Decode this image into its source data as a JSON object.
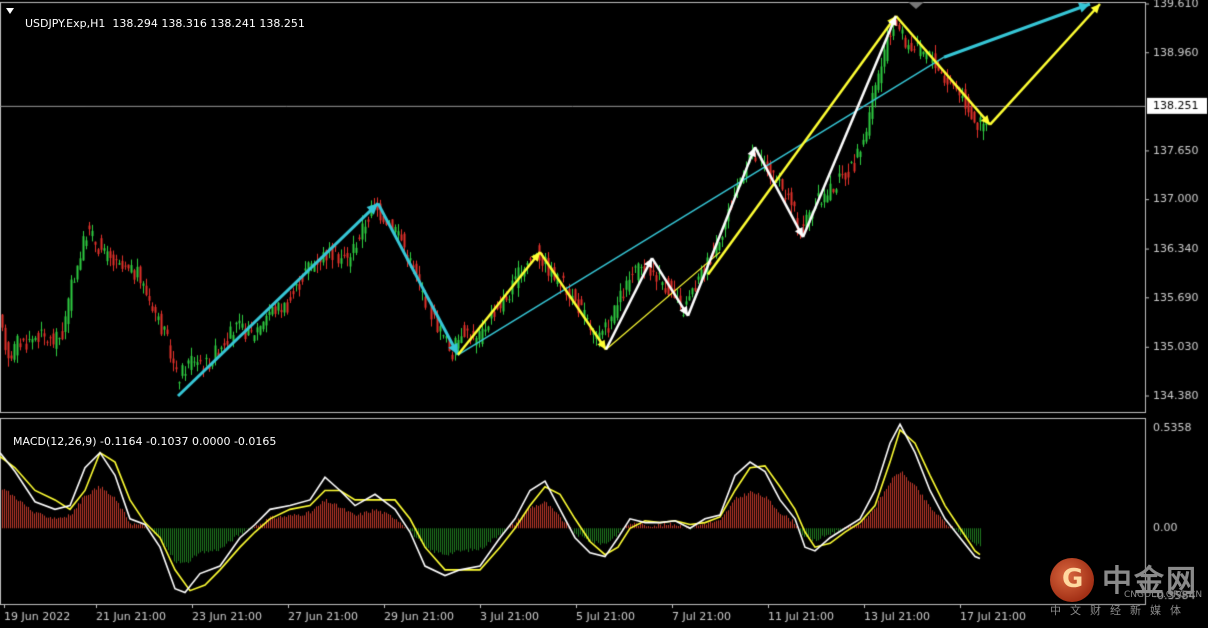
{
  "header": {
    "symbol": "USDJPY.Exp,H1",
    "open": "138.294",
    "high": "138.316",
    "low": "138.241",
    "close": "138.251"
  },
  "macd_header": {
    "name": "MACD(12,26,9)",
    "values": "-0.1164 -0.1037 0.0000 -0.0165"
  },
  "watermark": {
    "logo_glyph": "G",
    "name_cn": "中金网",
    "name_en": "CNGOLD.ORG.CN",
    "subtitle_cn": "中文财经新媒体"
  },
  "colors": {
    "background": "#000000",
    "bull": "#2ecc40",
    "bear": "#e0302a",
    "cyan": "#36c6d6",
    "yellow": "#ffff33",
    "white": "#ffffff",
    "macd_hist_pos": "#c0392b",
    "macd_hist_neg": "#1f7a1f",
    "axis": "#cccccc"
  },
  "chart_data": {
    "type": "candlestick",
    "price_ticks": [
      "139.610",
      "138.960",
      "138.251",
      "137.650",
      "137.000",
      "136.340",
      "135.690",
      "135.030",
      "134.380"
    ],
    "current_price_label": "138.251",
    "macd_ticks": [
      "0.5358",
      "0.00",
      "-0.3584"
    ],
    "time_labels": [
      "19 Jun 2022",
      "21 Jun 21:00",
      "23 Jun 21:00",
      "27 Jun 21:00",
      "29 Jun 21:00",
      "3 Jul 21:00",
      "5 Jul 21:00",
      "7 Jul 21:00",
      "11 Jul 21:00",
      "13 Jul 21:00",
      "17 Jul 21:00"
    ],
    "price_path": [
      [
        0,
        135.5
      ],
      [
        5,
        135.2
      ],
      [
        12,
        134.9
      ],
      [
        20,
        135.1
      ],
      [
        30,
        135.1
      ],
      [
        40,
        135.2
      ],
      [
        55,
        135.1
      ],
      [
        65,
        135.2
      ],
      [
        75,
        135.9
      ],
      [
        90,
        136.6
      ],
      [
        105,
        136.3
      ],
      [
        120,
        136.1
      ],
      [
        140,
        136.0
      ],
      [
        155,
        135.6
      ],
      [
        170,
        135.1
      ],
      [
        180,
        134.6
      ],
      [
        195,
        134.9
      ],
      [
        210,
        134.8
      ],
      [
        225,
        135.1
      ],
      [
        240,
        135.3
      ],
      [
        255,
        135.2
      ],
      [
        270,
        135.5
      ],
      [
        290,
        135.6
      ],
      [
        310,
        136.1
      ],
      [
        330,
        136.3
      ],
      [
        350,
        136.2
      ],
      [
        365,
        136.6
      ],
      [
        375,
        136.9
      ],
      [
        385,
        136.8
      ],
      [
        400,
        136.6
      ],
      [
        415,
        136.1
      ],
      [
        430,
        135.6
      ],
      [
        445,
        135.2
      ],
      [
        455,
        134.95
      ],
      [
        465,
        135.3
      ],
      [
        480,
        135.1
      ],
      [
        495,
        135.5
      ],
      [
        510,
        135.7
      ],
      [
        525,
        136.1
      ],
      [
        540,
        136.3
      ],
      [
        555,
        136.0
      ],
      [
        570,
        135.8
      ],
      [
        585,
        135.5
      ],
      [
        600,
        135.1
      ],
      [
        610,
        135.3
      ],
      [
        620,
        135.6
      ],
      [
        635,
        136.0
      ],
      [
        648,
        136.1
      ],
      [
        660,
        136.0
      ],
      [
        672,
        135.8
      ],
      [
        685,
        135.5
      ],
      [
        700,
        135.9
      ],
      [
        715,
        136.3
      ],
      [
        728,
        136.7
      ],
      [
        740,
        137.2
      ],
      [
        752,
        137.6
      ],
      [
        765,
        137.5
      ],
      [
        780,
        137.2
      ],
      [
        792,
        137.0
      ],
      [
        803,
        136.6
      ],
      [
        815,
        136.9
      ],
      [
        830,
        137.1
      ],
      [
        845,
        137.3
      ],
      [
        858,
        137.5
      ],
      [
        868,
        137.9
      ],
      [
        878,
        138.5
      ],
      [
        890,
        139.1
      ],
      [
        898,
        139.4
      ],
      [
        908,
        139.1
      ],
      [
        920,
        139.0
      ],
      [
        935,
        138.9
      ],
      [
        948,
        138.6
      ],
      [
        960,
        138.5
      ],
      [
        972,
        138.2
      ],
      [
        980,
        138.0
      ],
      [
        988,
        138.0
      ]
    ],
    "macd_line": [
      [
        0,
        0.4
      ],
      [
        15,
        0.3
      ],
      [
        35,
        0.14
      ],
      [
        55,
        0.1
      ],
      [
        70,
        0.12
      ],
      [
        85,
        0.32
      ],
      [
        100,
        0.4
      ],
      [
        115,
        0.28
      ],
      [
        130,
        0.05
      ],
      [
        145,
        0.02
      ],
      [
        160,
        -0.1
      ],
      [
        175,
        -0.32
      ],
      [
        185,
        -0.34
      ],
      [
        200,
        -0.24
      ],
      [
        220,
        -0.2
      ],
      [
        240,
        -0.05
      ],
      [
        255,
        0.02
      ],
      [
        270,
        0.1
      ],
      [
        290,
        0.12
      ],
      [
        310,
        0.15
      ],
      [
        325,
        0.27
      ],
      [
        340,
        0.2
      ],
      [
        355,
        0.12
      ],
      [
        375,
        0.18
      ],
      [
        395,
        0.1
      ],
      [
        410,
        -0.02
      ],
      [
        425,
        -0.2
      ],
      [
        445,
        -0.25
      ],
      [
        460,
        -0.22
      ],
      [
        480,
        -0.2
      ],
      [
        500,
        -0.05
      ],
      [
        515,
        0.05
      ],
      [
        530,
        0.2
      ],
      [
        545,
        0.25
      ],
      [
        560,
        0.1
      ],
      [
        575,
        -0.05
      ],
      [
        590,
        -0.13
      ],
      [
        605,
        -0.15
      ],
      [
        618,
        -0.05
      ],
      [
        630,
        0.05
      ],
      [
        645,
        0.03
      ],
      [
        660,
        0.03
      ],
      [
        675,
        0.04
      ],
      [
        690,
        0.0
      ],
      [
        705,
        0.05
      ],
      [
        720,
        0.07
      ],
      [
        735,
        0.28
      ],
      [
        750,
        0.35
      ],
      [
        765,
        0.3
      ],
      [
        780,
        0.15
      ],
      [
        795,
        0.05
      ],
      [
        805,
        -0.1
      ],
      [
        815,
        -0.12
      ],
      [
        830,
        -0.05
      ],
      [
        845,
        0.0
      ],
      [
        860,
        0.05
      ],
      [
        875,
        0.2
      ],
      [
        890,
        0.45
      ],
      [
        900,
        0.55
      ],
      [
        915,
        0.4
      ],
      [
        930,
        0.2
      ],
      [
        945,
        0.05
      ],
      [
        960,
        -0.05
      ],
      [
        975,
        -0.15
      ],
      [
        980,
        -0.16
      ]
    ],
    "signal_line": [
      [
        0,
        0.38
      ],
      [
        15,
        0.32
      ],
      [
        35,
        0.2
      ],
      [
        55,
        0.15
      ],
      [
        70,
        0.1
      ],
      [
        85,
        0.2
      ],
      [
        100,
        0.4
      ],
      [
        115,
        0.35
      ],
      [
        130,
        0.15
      ],
      [
        145,
        0.03
      ],
      [
        160,
        -0.05
      ],
      [
        175,
        -0.22
      ],
      [
        190,
        -0.33
      ],
      [
        205,
        -0.3
      ],
      [
        220,
        -0.22
      ],
      [
        240,
        -0.1
      ],
      [
        255,
        -0.02
      ],
      [
        270,
        0.05
      ],
      [
        290,
        0.1
      ],
      [
        310,
        0.12
      ],
      [
        325,
        0.2
      ],
      [
        340,
        0.2
      ],
      [
        355,
        0.15
      ],
      [
        375,
        0.15
      ],
      [
        395,
        0.15
      ],
      [
        410,
        0.05
      ],
      [
        425,
        -0.1
      ],
      [
        445,
        -0.22
      ],
      [
        460,
        -0.22
      ],
      [
        480,
        -0.22
      ],
      [
        500,
        -0.1
      ],
      [
        515,
        0.0
      ],
      [
        530,
        0.12
      ],
      [
        545,
        0.22
      ],
      [
        560,
        0.18
      ],
      [
        575,
        0.05
      ],
      [
        590,
        -0.07
      ],
      [
        605,
        -0.14
      ],
      [
        618,
        -0.1
      ],
      [
        630,
        0.0
      ],
      [
        645,
        0.04
      ],
      [
        660,
        0.03
      ],
      [
        675,
        0.04
      ],
      [
        690,
        0.02
      ],
      [
        705,
        0.03
      ],
      [
        720,
        0.06
      ],
      [
        735,
        0.2
      ],
      [
        750,
        0.32
      ],
      [
        765,
        0.33
      ],
      [
        780,
        0.22
      ],
      [
        795,
        0.1
      ],
      [
        805,
        -0.02
      ],
      [
        815,
        -0.1
      ],
      [
        830,
        -0.08
      ],
      [
        845,
        -0.02
      ],
      [
        860,
        0.03
      ],
      [
        875,
        0.12
      ],
      [
        890,
        0.35
      ],
      [
        900,
        0.52
      ],
      [
        915,
        0.45
      ],
      [
        930,
        0.28
      ],
      [
        945,
        0.12
      ],
      [
        960,
        0.0
      ],
      [
        975,
        -0.12
      ],
      [
        980,
        -0.14
      ]
    ],
    "overlays": {
      "cyan_thick": [
        [
          [
            178,
            134.38
          ],
          [
            378,
            136.95
          ]
        ],
        [
          [
            378,
            136.95
          ],
          [
            458,
            134.93
          ]
        ],
        [
          [
            944,
            138.9
          ],
          [
            1090,
            139.61
          ]
        ]
      ],
      "cyan_thin": [
        [
          [
            458,
            134.93
          ],
          [
            944,
            138.9
          ]
        ]
      ],
      "yellow_thick": [
        [
          [
            458,
            134.93
          ],
          [
            540,
            136.3
          ]
        ],
        [
          [
            540,
            136.3
          ],
          [
            606,
            135.0
          ]
        ],
        [
          [
            708,
            136.0
          ],
          [
            896,
            139.45
          ]
        ],
        [
          [
            896,
            139.45
          ],
          [
            990,
            138.0
          ]
        ],
        [
          [
            990,
            138.0
          ],
          [
            1100,
            139.61
          ]
        ]
      ],
      "yellow_thin": [
        [
          [
            606,
            135.0
          ],
          [
            720,
            136.3
          ]
        ]
      ],
      "white": [
        [
          [
            606,
            135.0
          ],
          [
            652,
            136.22
          ]
        ],
        [
          [
            652,
            136.22
          ],
          [
            688,
            135.45
          ]
        ],
        [
          [
            688,
            135.45
          ],
          [
            755,
            137.7
          ]
        ],
        [
          [
            755,
            137.7
          ],
          [
            803,
            136.5
          ]
        ],
        [
          [
            803,
            136.5
          ],
          [
            896,
            139.45
          ]
        ]
      ]
    }
  }
}
